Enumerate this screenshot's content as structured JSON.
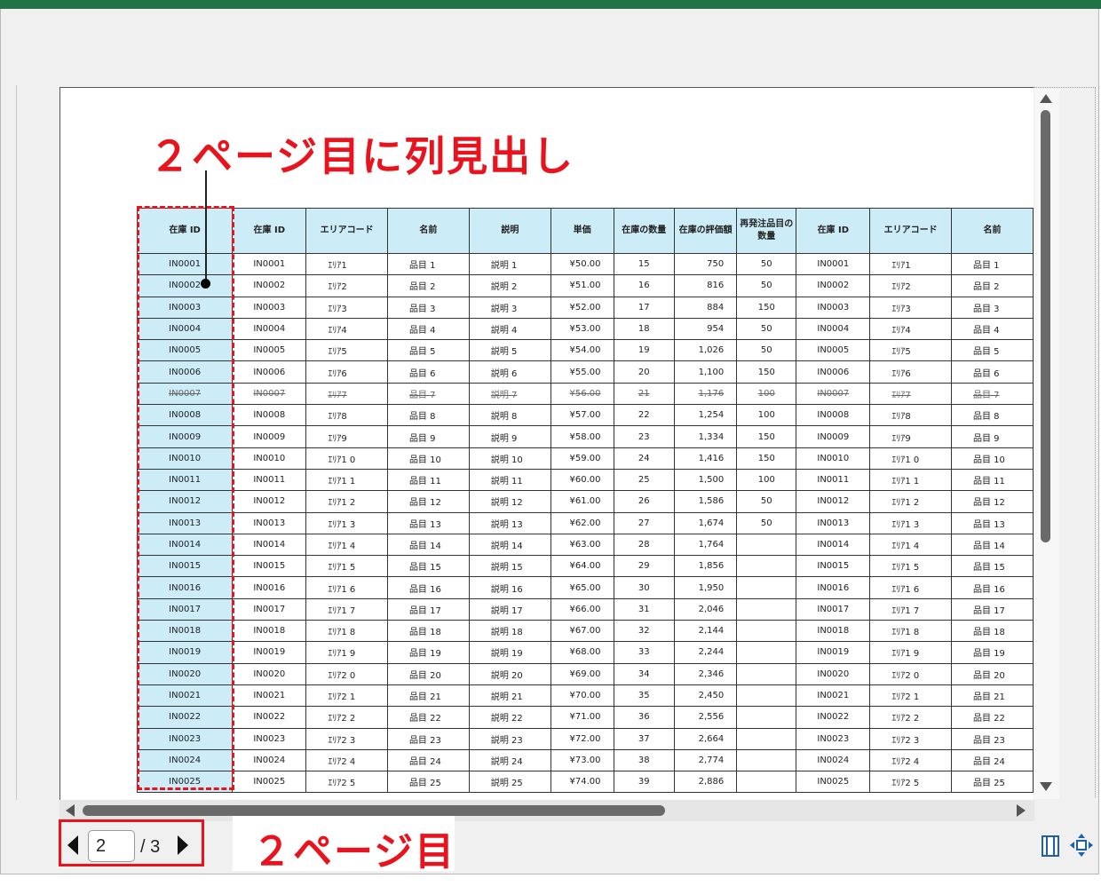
{
  "annotations": {
    "title": "２ページ目に列見出し",
    "page_label": "２ページ目"
  },
  "colors": {
    "accent": "#e8131c",
    "header_fill": "#ccecf7",
    "ribbon": "#217346"
  },
  "pager": {
    "current": "2",
    "total": "/ 3"
  },
  "icons": [
    "prev-page-icon",
    "next-page-icon",
    "page-layout-icon",
    "fit-to-window-icon",
    "scroll-up-icon",
    "scroll-down-icon",
    "scroll-left-icon",
    "scroll-right-icon"
  ],
  "sheet": {
    "headers": [
      "在庫 ID",
      "在庫 ID",
      "エリアコード",
      "名前",
      "説明",
      "単価",
      "在庫の数量",
      "在庫の評価額",
      "再発注品目の数量",
      "在庫 ID",
      "エリアコード",
      "名前"
    ],
    "rows": [
      [
        "IN0001",
        "IN0001",
        "ｴﾘｱ1",
        "品目 1",
        "説明 1",
        "¥50.00",
        "15",
        "750",
        "50",
        "IN0001",
        "ｴﾘｱ1",
        "品目 1"
      ],
      [
        "IN0002",
        "IN0002",
        "ｴﾘｱ2",
        "品目 2",
        "説明 2",
        "¥51.00",
        "16",
        "816",
        "50",
        "IN0002",
        "ｴﾘｱ2",
        "品目 2"
      ],
      [
        "IN0003",
        "IN0003",
        "ｴﾘｱ3",
        "品目 3",
        "説明 3",
        "¥52.00",
        "17",
        "884",
        "150",
        "IN0003",
        "ｴﾘｱ3",
        "品目 3"
      ],
      [
        "IN0004",
        "IN0004",
        "ｴﾘｱ4",
        "品目 4",
        "説明 4",
        "¥53.00",
        "18",
        "954",
        "50",
        "IN0004",
        "ｴﾘｱ4",
        "品目 4"
      ],
      [
        "IN0005",
        "IN0005",
        "ｴﾘｱ5",
        "品目 5",
        "説明 5",
        "¥54.00",
        "19",
        "1,026",
        "50",
        "IN0005",
        "ｴﾘｱ5",
        "品目 5"
      ],
      [
        "IN0006",
        "IN0006",
        "ｴﾘｱ6",
        "品目 6",
        "説明 6",
        "¥55.00",
        "20",
        "1,100",
        "150",
        "IN0006",
        "ｴﾘｱ6",
        "品目 6"
      ],
      [
        "IN0007",
        "IN0007",
        "ｴﾘｱ7",
        "品目 7",
        "説明 7",
        "¥56.00",
        "21",
        "1,176",
        "100",
        "IN0007",
        "ｴﾘｱ7",
        "品目 7"
      ],
      [
        "IN0008",
        "IN0008",
        "ｴﾘｱ8",
        "品目 8",
        "説明 8",
        "¥57.00",
        "22",
        "1,254",
        "100",
        "IN0008",
        "ｴﾘｱ8",
        "品目 8"
      ],
      [
        "IN0009",
        "IN0009",
        "ｴﾘｱ9",
        "品目 9",
        "説明 9",
        "¥58.00",
        "23",
        "1,334",
        "150",
        "IN0009",
        "ｴﾘｱ9",
        "品目 9"
      ],
      [
        "IN0010",
        "IN0010",
        "ｴﾘｱ1 0",
        "品目 10",
        "説明 10",
        "¥59.00",
        "24",
        "1,416",
        "150",
        "IN0010",
        "ｴﾘｱ1 0",
        "品目 10"
      ],
      [
        "IN0011",
        "IN0011",
        "ｴﾘｱ1 1",
        "品目 11",
        "説明 11",
        "¥60.00",
        "25",
        "1,500",
        "100",
        "IN0011",
        "ｴﾘｱ1 1",
        "品目 11"
      ],
      [
        "IN0012",
        "IN0012",
        "ｴﾘｱ1 2",
        "品目 12",
        "説明 12",
        "¥61.00",
        "26",
        "1,586",
        "50",
        "IN0012",
        "ｴﾘｱ1 2",
        "品目 12"
      ],
      [
        "IN0013",
        "IN0013",
        "ｴﾘｱ1 3",
        "品目 13",
        "説明 13",
        "¥62.00",
        "27",
        "1,674",
        "50",
        "IN0013",
        "ｴﾘｱ1 3",
        "品目 13"
      ],
      [
        "IN0014",
        "IN0014",
        "ｴﾘｱ1 4",
        "品目 14",
        "説明 14",
        "¥63.00",
        "28",
        "1,764",
        "",
        "IN0014",
        "ｴﾘｱ1 4",
        "品目 14"
      ],
      [
        "IN0015",
        "IN0015",
        "ｴﾘｱ1 5",
        "品目 15",
        "説明 15",
        "¥64.00",
        "29",
        "1,856",
        "",
        "IN0015",
        "ｴﾘｱ1 5",
        "品目 15"
      ],
      [
        "IN0016",
        "IN0016",
        "ｴﾘｱ1 6",
        "品目 16",
        "説明 16",
        "¥65.00",
        "30",
        "1,950",
        "",
        "IN0016",
        "ｴﾘｱ1 6",
        "品目 16"
      ],
      [
        "IN0017",
        "IN0017",
        "ｴﾘｱ1 7",
        "品目 17",
        "説明 17",
        "¥66.00",
        "31",
        "2,046",
        "",
        "IN0017",
        "ｴﾘｱ1 7",
        "品目 17"
      ],
      [
        "IN0018",
        "IN0018",
        "ｴﾘｱ1 8",
        "品目 18",
        "説明 18",
        "¥67.00",
        "32",
        "2,144",
        "",
        "IN0018",
        "ｴﾘｱ1 8",
        "品目 18"
      ],
      [
        "IN0019",
        "IN0019",
        "ｴﾘｱ1 9",
        "品目 19",
        "説明 19",
        "¥68.00",
        "33",
        "2,244",
        "",
        "IN0019",
        "ｴﾘｱ1 9",
        "品目 19"
      ],
      [
        "IN0020",
        "IN0020",
        "ｴﾘｱ2 0",
        "品目 20",
        "説明 20",
        "¥69.00",
        "34",
        "2,346",
        "",
        "IN0020",
        "ｴﾘｱ2 0",
        "品目 20"
      ],
      [
        "IN0021",
        "IN0021",
        "ｴﾘｱ2 1",
        "品目 21",
        "説明 21",
        "¥70.00",
        "35",
        "2,450",
        "",
        "IN0021",
        "ｴﾘｱ2 1",
        "品目 21"
      ],
      [
        "IN0022",
        "IN0022",
        "ｴﾘｱ2 2",
        "品目 22",
        "説明 22",
        "¥71.00",
        "36",
        "2,556",
        "",
        "IN0022",
        "ｴﾘｱ2 2",
        "品目 22"
      ],
      [
        "IN0023",
        "IN0023",
        "ｴﾘｱ2 3",
        "品目 23",
        "説明 23",
        "¥72.00",
        "37",
        "2,664",
        "",
        "IN0023",
        "ｴﾘｱ2 3",
        "品目 23"
      ],
      [
        "IN0024",
        "IN0024",
        "ｴﾘｱ2 4",
        "品目 24",
        "説明 24",
        "¥73.00",
        "38",
        "2,774",
        "",
        "IN0024",
        "ｴﾘｱ2 4",
        "品目 24"
      ],
      [
        "IN0025",
        "IN0025",
        "ｴﾘｱ2 5",
        "品目 25",
        "説明 25",
        "¥74.00",
        "39",
        "2,886",
        "",
        "IN0025",
        "ｴﾘｱ2 5",
        "品目 25"
      ]
    ],
    "strikethrough_row_index": 6
  }
}
